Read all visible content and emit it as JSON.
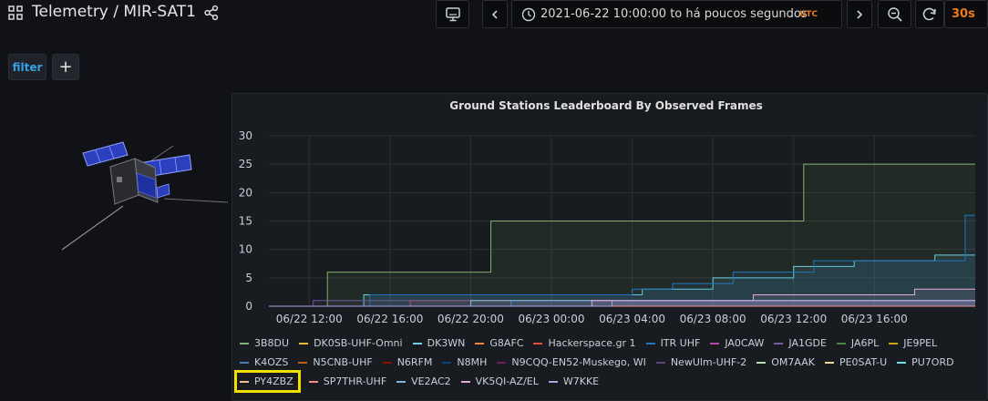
{
  "header": {
    "title": "Telemetry / MIR-SAT1",
    "time_range": "2021-06-22 10:00:00 to há poucos segundos",
    "timezone": "UTC",
    "refresh_interval": "30s"
  },
  "variables": {
    "filter_label": "filter",
    "add_label": "+"
  },
  "colors": {
    "accent_orange": "#eb7b18",
    "highlight": "#f2e100",
    "filter_blue": "#33a2e5"
  },
  "icons": [
    "apps-icon",
    "share-icon",
    "monitor-icon",
    "chevron-left-icon",
    "clock-icon",
    "chevron-right-icon",
    "zoom-out-icon",
    "refresh-icon"
  ],
  "chart_data": {
    "type": "area",
    "title": "Ground Stations Leaderboard By Observed Frames",
    "xlabel": "",
    "ylabel": "",
    "ylim": [
      0,
      30
    ],
    "yticks": [
      "0",
      "5",
      "10",
      "15",
      "20",
      "25",
      "30"
    ],
    "xticks": [
      "06/22 12:00",
      "06/22 16:00",
      "06/22 20:00",
      "06/23 00:00",
      "06/23 04:00",
      "06/23 08:00",
      "06/23 12:00",
      "06/23 16:00"
    ],
    "xticks_hours": [
      2,
      6,
      10,
      14,
      18,
      22,
      26,
      30
    ],
    "xlim_hours": [
      0,
      35
    ],
    "grid": true,
    "legend_position": "bottom",
    "series": [
      {
        "name": "3B8DU",
        "color": "#7eb26d",
        "points": [
          [
            0,
            0
          ],
          [
            2.9,
            0
          ],
          [
            2.9,
            6
          ],
          [
            11,
            6
          ],
          [
            11,
            15
          ],
          [
            26.5,
            15
          ],
          [
            26.5,
            25
          ],
          [
            35,
            25
          ]
        ]
      },
      {
        "name": "DK0SB-UHF-Omni",
        "color": "#eab839",
        "points": [
          [
            0,
            0
          ],
          [
            35,
            0
          ]
        ]
      },
      {
        "name": "DK3WN",
        "color": "#6ed0e0",
        "points": [
          [
            0,
            0
          ],
          [
            4.7,
            0
          ],
          [
            4.7,
            2
          ],
          [
            18.5,
            2
          ],
          [
            18.5,
            3
          ],
          [
            22,
            3
          ],
          [
            22,
            5
          ],
          [
            26,
            5
          ],
          [
            26,
            7
          ],
          [
            29,
            7
          ],
          [
            29,
            8
          ],
          [
            33,
            8
          ],
          [
            33,
            9
          ],
          [
            35,
            9
          ]
        ]
      },
      {
        "name": "G8AFC",
        "color": "#ef843c",
        "points": [
          [
            0,
            0
          ],
          [
            35,
            0
          ]
        ]
      },
      {
        "name": "Hackerspace.gr 1",
        "color": "#e24d42",
        "points": [
          [
            0,
            0
          ],
          [
            7,
            0
          ],
          [
            7,
            1
          ],
          [
            35,
            1
          ]
        ]
      },
      {
        "name": "ITR UHF",
        "color": "#1f78c1",
        "points": [
          [
            0,
            0
          ],
          [
            5,
            0
          ],
          [
            5,
            2
          ],
          [
            18,
            2
          ],
          [
            18,
            3
          ],
          [
            20,
            3
          ],
          [
            20,
            4
          ],
          [
            23,
            4
          ],
          [
            23,
            6
          ],
          [
            27,
            6
          ],
          [
            27,
            8
          ],
          [
            34.5,
            8
          ],
          [
            34.5,
            16
          ],
          [
            35,
            16
          ]
        ]
      },
      {
        "name": "JA0CAW",
        "color": "#ba43a9",
        "points": [
          [
            0,
            0
          ],
          [
            35,
            0
          ]
        ]
      },
      {
        "name": "JA1GDE",
        "color": "#705da0",
        "points": [
          [
            0,
            0
          ],
          [
            2.2,
            0
          ],
          [
            2.2,
            1
          ],
          [
            35,
            1
          ]
        ]
      },
      {
        "name": "JA6PL",
        "color": "#508642",
        "points": [
          [
            0,
            0
          ],
          [
            35,
            0
          ]
        ]
      },
      {
        "name": "JE9PEL",
        "color": "#cca300",
        "points": [
          [
            0,
            0
          ],
          [
            35,
            0
          ]
        ]
      },
      {
        "name": "K4OZS",
        "color": "#447ebc",
        "points": [
          [
            0,
            0
          ],
          [
            12,
            0
          ],
          [
            12,
            1
          ],
          [
            35,
            1
          ]
        ]
      },
      {
        "name": "N5CNB-UHF",
        "color": "#c15c17",
        "points": [
          [
            0,
            0
          ],
          [
            35,
            0
          ]
        ]
      },
      {
        "name": "N6RFM",
        "color": "#890f02",
        "points": [
          [
            0,
            0
          ],
          [
            35,
            0
          ]
        ]
      },
      {
        "name": "N8MH",
        "color": "#0a437c",
        "points": [
          [
            0,
            0
          ],
          [
            35,
            0
          ]
        ]
      },
      {
        "name": "N9CQQ-EN52-Muskego, WI",
        "color": "#6d1f62",
        "points": [
          [
            0,
            0
          ],
          [
            35,
            0
          ]
        ]
      },
      {
        "name": "NewUlm-UHF-2",
        "color": "#584477",
        "points": [
          [
            0,
            0
          ],
          [
            35,
            0
          ]
        ]
      },
      {
        "name": "OM7AAK",
        "color": "#b7dbab",
        "points": [
          [
            0,
            0
          ],
          [
            35,
            0
          ]
        ]
      },
      {
        "name": "PE0SAT-U",
        "color": "#f4d598",
        "points": [
          [
            0,
            0
          ],
          [
            35,
            0
          ]
        ]
      },
      {
        "name": "PU7ORD",
        "color": "#70dbed",
        "points": [
          [
            0,
            0
          ],
          [
            35,
            0
          ]
        ]
      },
      {
        "name": "PY4ZBZ",
        "color": "#f9ba8f",
        "points": [
          [
            0,
            0
          ],
          [
            35,
            0
          ]
        ]
      },
      {
        "name": "SP7THR-UHF",
        "color": "#f29191",
        "points": [
          [
            0,
            0
          ],
          [
            35,
            0
          ]
        ]
      },
      {
        "name": "VE2AC2",
        "color": "#82b5d8",
        "points": [
          [
            0,
            0
          ],
          [
            10,
            0
          ],
          [
            10,
            1
          ],
          [
            35,
            1
          ]
        ]
      },
      {
        "name": "VK5QI-AZ/EL",
        "color": "#e5a8e2",
        "points": [
          [
            0,
            0
          ],
          [
            16,
            0
          ],
          [
            16,
            1
          ],
          [
            24,
            1
          ],
          [
            24,
            2
          ],
          [
            32,
            2
          ],
          [
            32,
            3
          ],
          [
            35,
            3
          ]
        ]
      },
      {
        "name": "W7KKE",
        "color": "#aea2e0",
        "points": [
          [
            0,
            0
          ],
          [
            17,
            0
          ],
          [
            17,
            1
          ],
          [
            35,
            1
          ]
        ]
      }
    ],
    "highlighted_series": "PY4ZBZ"
  }
}
